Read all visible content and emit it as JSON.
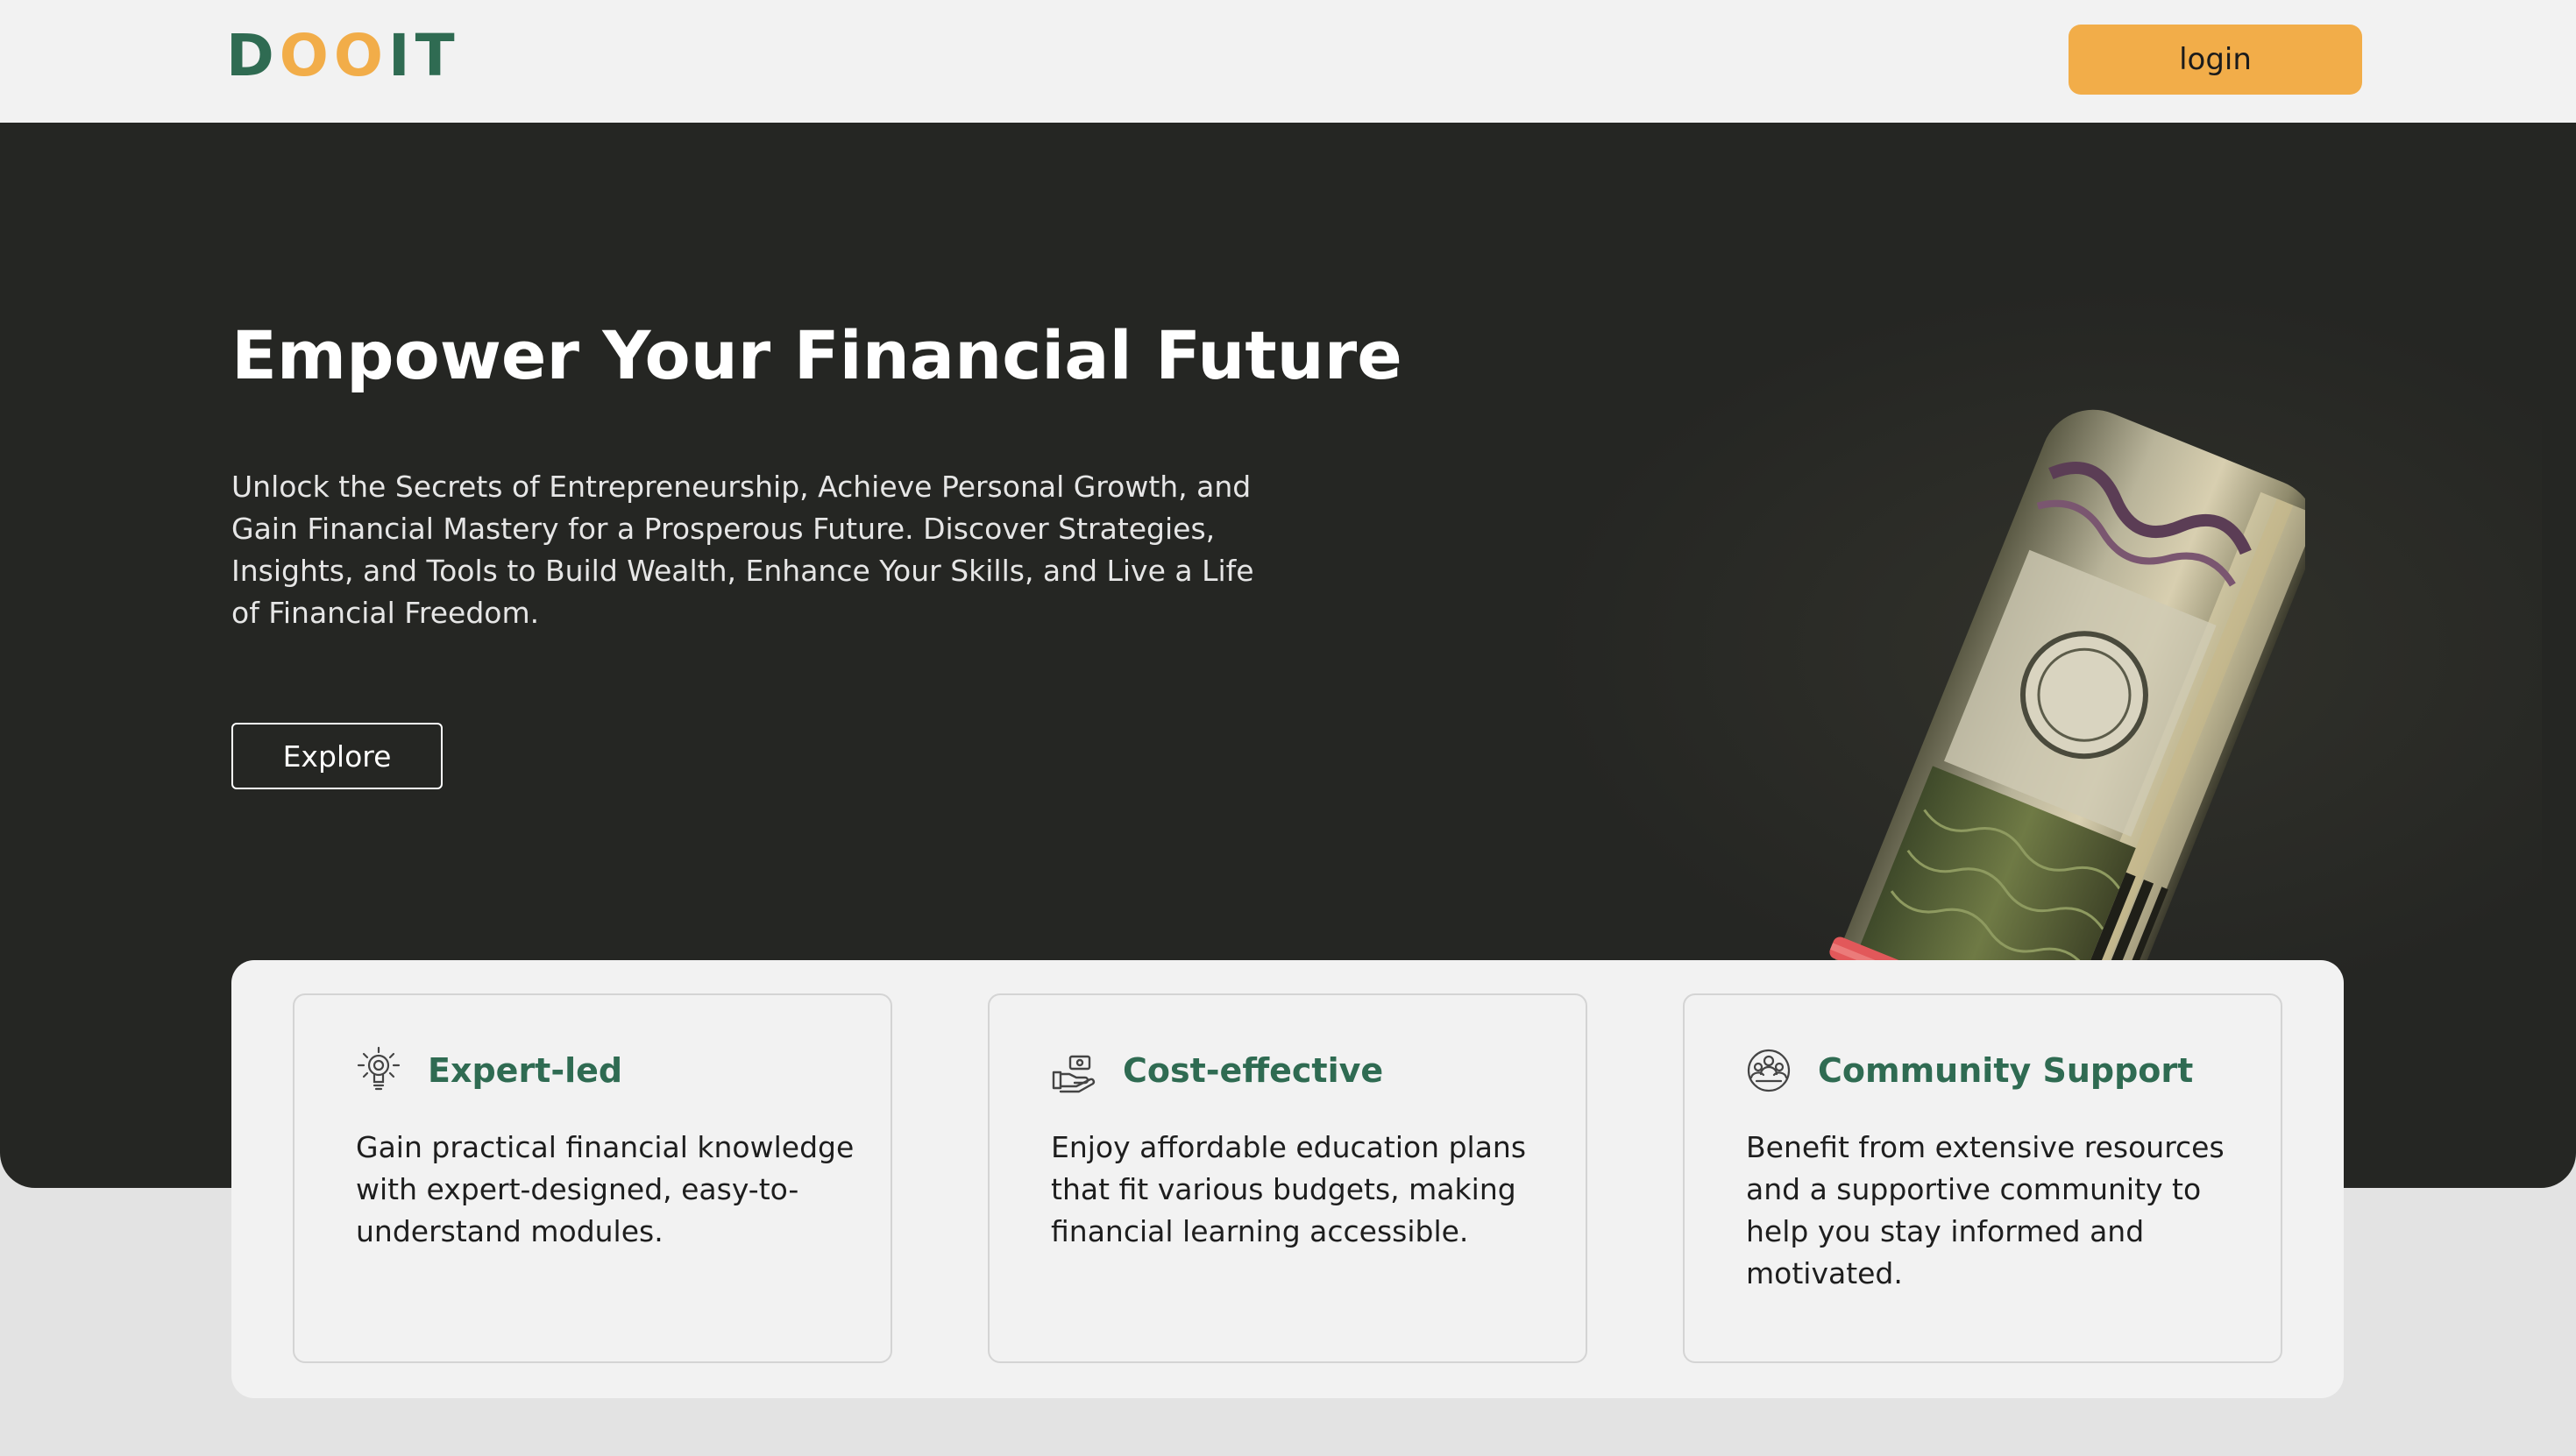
{
  "header": {
    "logo_text": "DOOIT",
    "login_label": "login"
  },
  "hero": {
    "title": "Empower Your Financial Future",
    "subtitle": "Unlock the Secrets of Entrepreneurship, Achieve Personal Growth, and Gain Financial Mastery for a Prosperous Future. Discover Strategies, Insights, and Tools to Build Wealth, Enhance Your Skills, and Live a Life of Financial Freedom.",
    "explore_label": "Explore",
    "image": "rolled-banknotes-photo"
  },
  "features": [
    {
      "icon": "lightbulb-icon",
      "title": "Expert-led",
      "text": "Gain practical financial knowledge with expert-designed, easy-to-understand modules."
    },
    {
      "icon": "hand-money-icon",
      "title": "Cost-effective",
      "text": "Enjoy affordable education plans that fit various budgets, making financial learning accessible."
    },
    {
      "icon": "community-icon",
      "title": "Community Support",
      "text": "Benefit from extensive resources and a supportive community to help you stay informed and motivated."
    }
  ],
  "colors": {
    "brand_green": "#2f6b52",
    "brand_orange": "#f2ad49",
    "hero_background": "#252623",
    "page_background": "#e3e3e3"
  }
}
